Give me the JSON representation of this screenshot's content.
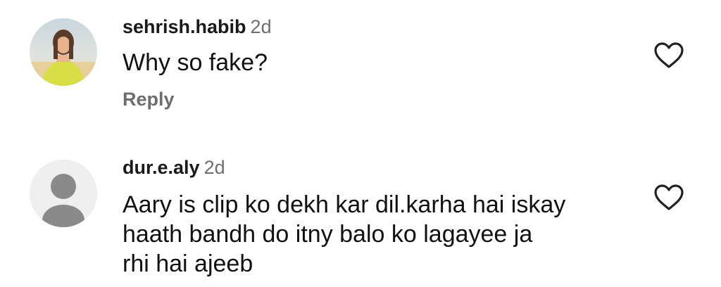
{
  "comments": [
    {
      "username": "sehrish.habib",
      "time": "2d",
      "text": "Why so fake?",
      "reply": "Reply",
      "avatar": "photo-avatar",
      "like_icon": "heart-outline-icon"
    },
    {
      "username": "dur.e.aly",
      "time": "2d",
      "text_lines": [
        "Aary is clip ko dekh kar dil.karha hai iskay",
        "haath bandh do itny balo ko lagayee ja",
        "rhi hai ajeeb"
      ],
      "avatar": "default-user-avatar",
      "like_icon": "heart-outline-icon"
    }
  ],
  "colors": {
    "text": "#111111",
    "secondary": "#6e6e6e",
    "avatar_default_bg": "#efefef",
    "avatar_default_fg": "#8a8a8a",
    "icon_stroke": "#222222"
  }
}
